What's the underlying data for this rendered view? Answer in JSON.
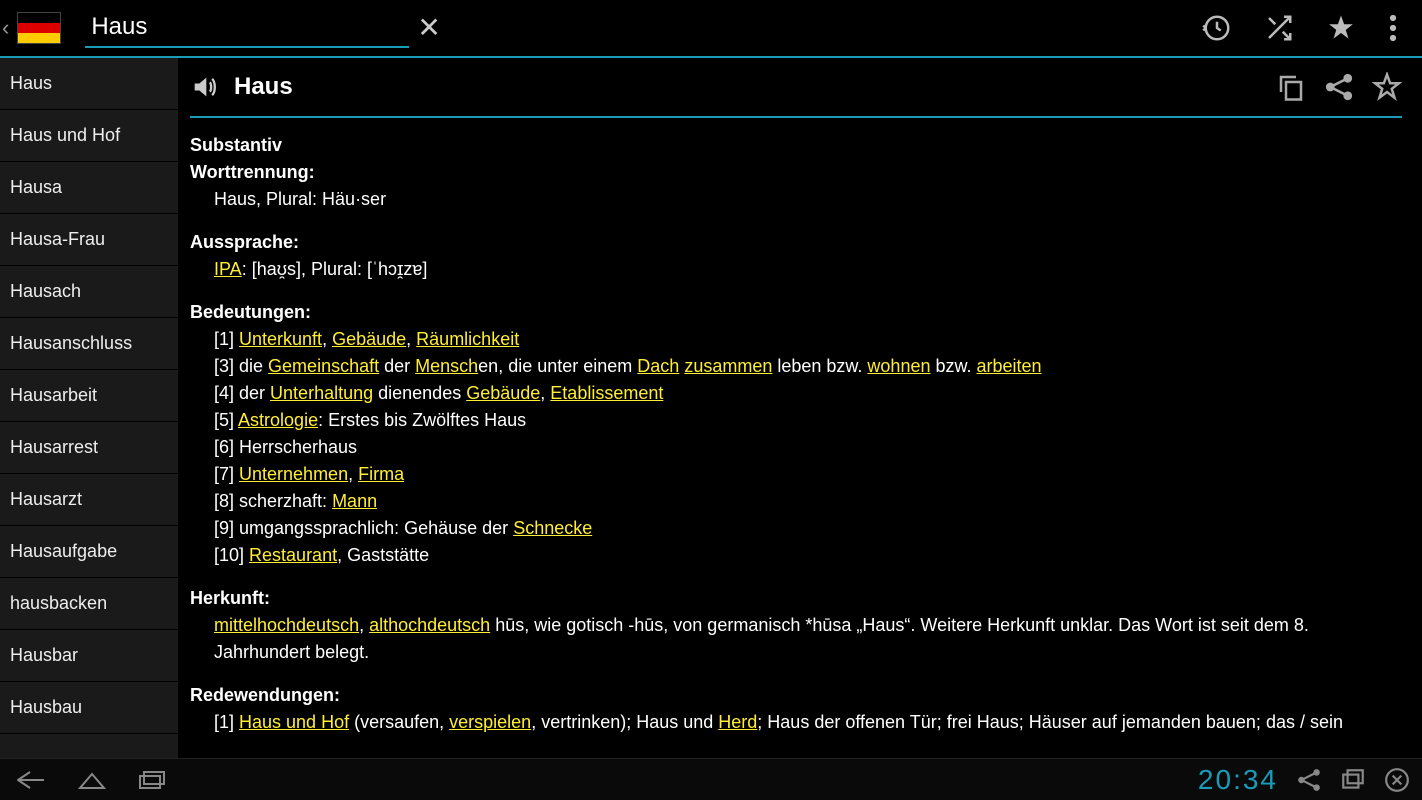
{
  "search": {
    "value": "Haus"
  },
  "sidebar": {
    "items": [
      "Haus",
      "Haus und Hof",
      "Hausa",
      "Hausa-Frau",
      "Hausach",
      "Hausanschluss",
      "Hausarbeit",
      "Hausarrest",
      "Hausarzt",
      "Hausaufgabe",
      "hausbacken",
      "Hausbar",
      "Hausbau"
    ]
  },
  "entry": {
    "headword": "Haus",
    "pos": "Substantiv",
    "worttrennung_label": "Worttrennung:",
    "worttrennung_value": "Haus, Plural: Häu·ser",
    "aussprache_label": "Aussprache:",
    "ipa_link": "IPA",
    "ipa_value": ": [haʊ̯s], Plural: [ˈhɔɪ̯zɐ]",
    "bedeutungen_label": "Bedeutungen:",
    "meanings": [
      {
        "num": "[1]",
        "parts": [
          {
            "t": "link",
            "v": "Unterkunft"
          },
          {
            "t": "text",
            "v": ", "
          },
          {
            "t": "link",
            "v": "Gebäude"
          },
          {
            "t": "text",
            "v": ", "
          },
          {
            "t": "link",
            "v": "Räumlichkeit"
          }
        ]
      },
      {
        "num": "[3]",
        "parts": [
          {
            "t": "text",
            "v": "die "
          },
          {
            "t": "link",
            "v": "Gemeinschaft"
          },
          {
            "t": "text",
            "v": " der "
          },
          {
            "t": "link",
            "v": "Mensch"
          },
          {
            "t": "text",
            "v": "en, die unter einem "
          },
          {
            "t": "link",
            "v": "Dach"
          },
          {
            "t": "text",
            "v": " "
          },
          {
            "t": "link",
            "v": "zusammen"
          },
          {
            "t": "text",
            "v": " leben bzw. "
          },
          {
            "t": "link",
            "v": "wohnen"
          },
          {
            "t": "text",
            "v": " bzw. "
          },
          {
            "t": "link",
            "v": "arbeiten"
          }
        ]
      },
      {
        "num": "[4]",
        "parts": [
          {
            "t": "text",
            "v": "der "
          },
          {
            "t": "link",
            "v": "Unterhaltung"
          },
          {
            "t": "text",
            "v": " dienendes "
          },
          {
            "t": "link",
            "v": "Gebäude"
          },
          {
            "t": "text",
            "v": ", "
          },
          {
            "t": "link",
            "v": "Etablissement"
          }
        ]
      },
      {
        "num": "[5]",
        "parts": [
          {
            "t": "link",
            "v": "Astrologie"
          },
          {
            "t": "text",
            "v": ": Erstes bis Zwölftes Haus"
          }
        ]
      },
      {
        "num": "[6]",
        "parts": [
          {
            "t": "text",
            "v": "Herrscherhaus"
          }
        ]
      },
      {
        "num": "[7]",
        "parts": [
          {
            "t": "link",
            "v": "Unternehmen"
          },
          {
            "t": "text",
            "v": ", "
          },
          {
            "t": "link",
            "v": "Firma"
          }
        ]
      },
      {
        "num": "[8]",
        "parts": [
          {
            "t": "text",
            "v": "scherzhaft: "
          },
          {
            "t": "link",
            "v": "Mann"
          }
        ]
      },
      {
        "num": "[9]",
        "parts": [
          {
            "t": "text",
            "v": "umgangssprachlich: Gehäuse der "
          },
          {
            "t": "link",
            "v": "Schnecke"
          }
        ]
      },
      {
        "num": "[10]",
        "parts": [
          {
            "t": "link",
            "v": "Restaurant"
          },
          {
            "t": "text",
            "v": ", Gaststätte"
          }
        ]
      }
    ],
    "herkunft_label": "Herkunft:",
    "herkunft_parts": [
      {
        "t": "link",
        "v": "mittelhochdeutsch"
      },
      {
        "t": "text",
        "v": ", "
      },
      {
        "t": "link",
        "v": "althochdeutsch"
      },
      {
        "t": "text",
        "v": " hūs, wie gotisch -hūs, von germanisch *hūsa „Haus“. Weitere Herkunft unklar. Das Wort ist seit dem 8. Jahrhundert belegt."
      }
    ],
    "redewendungen_label": "Redewendungen:",
    "redewendungen": {
      "num": "[1]",
      "parts": [
        {
          "t": "link",
          "v": "Haus und Hof"
        },
        {
          "t": "text",
          "v": " (versaufen, "
        },
        {
          "t": "link",
          "v": "verspielen"
        },
        {
          "t": "text",
          "v": ", vertrinken); Haus und "
        },
        {
          "t": "link",
          "v": "Herd"
        },
        {
          "t": "text",
          "v": "; Haus der offenen Tür; frei Haus; Häuser auf jemanden bauen; das / sein"
        }
      ]
    }
  },
  "statusbar": {
    "time": "20:34"
  }
}
